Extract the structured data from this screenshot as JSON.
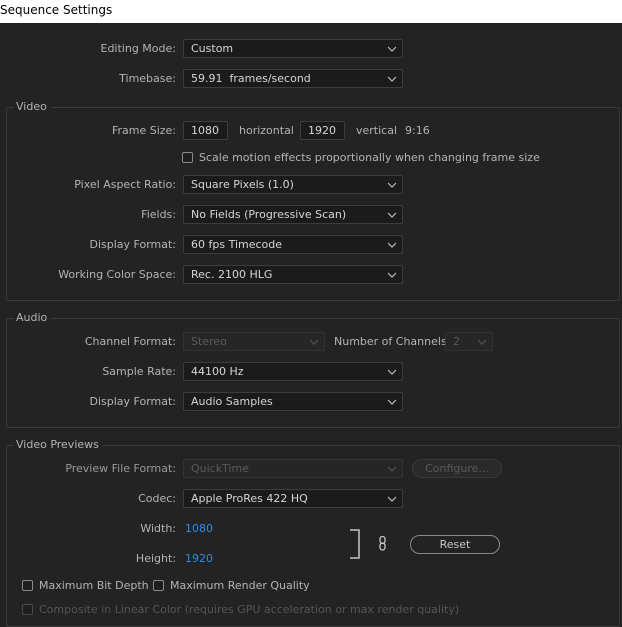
{
  "window": {
    "title": "Sequence Settings"
  },
  "general": {
    "editing_mode_label": "Editing Mode:",
    "editing_mode_value": "Custom",
    "timebase_label": "Timebase:",
    "timebase_value": "59.91  frames/second"
  },
  "video": {
    "section_title": "Video",
    "frame_size_label": "Frame Size:",
    "frame_width": "1080",
    "horizontal_label": "horizontal",
    "frame_height": "1920",
    "vertical_label": "vertical",
    "aspect": "9:16",
    "scale_motion_label": "Scale motion effects proportionally when changing frame size",
    "scale_motion_checked": false,
    "pixel_aspect_label": "Pixel Aspect Ratio:",
    "pixel_aspect_value": "Square Pixels (1.0)",
    "fields_label": "Fields:",
    "fields_value": "No Fields (Progressive Scan)",
    "display_format_label": "Display Format:",
    "display_format_value": "60 fps Timecode",
    "color_space_label": "Working Color Space:",
    "color_space_value": "Rec. 2100 HLG"
  },
  "audio": {
    "section_title": "Audio",
    "channel_format_label": "Channel Format:",
    "channel_format_value": "Stereo",
    "num_channels_label": "Number of Channels:",
    "num_channels_value": "2",
    "sample_rate_label": "Sample Rate:",
    "sample_rate_value": "44100 Hz",
    "display_format_label": "Display Format:",
    "display_format_value": "Audio Samples"
  },
  "previews": {
    "section_title": "Video Previews",
    "preview_format_label": "Preview File Format:",
    "preview_format_value": "QuickTime",
    "configure_label": "Configure...",
    "codec_label": "Codec:",
    "codec_value": "Apple ProRes 422 HQ",
    "width_label": "Width:",
    "width_value": "1080",
    "height_label": "Height:",
    "height_value": "1920",
    "reset_label": "Reset",
    "max_bit_depth_label": "Maximum Bit Depth",
    "max_render_quality_label": "Maximum Render Quality",
    "composite_label": "Composite in Linear Color (requires GPU acceleration or max render quality)"
  },
  "icons": {
    "dropdown": "chevron-down-icon",
    "link": "link-icon"
  },
  "colors": {
    "background": "#232323",
    "accent_blue": "#2d8ceb",
    "title_bar": "#ffffff"
  }
}
